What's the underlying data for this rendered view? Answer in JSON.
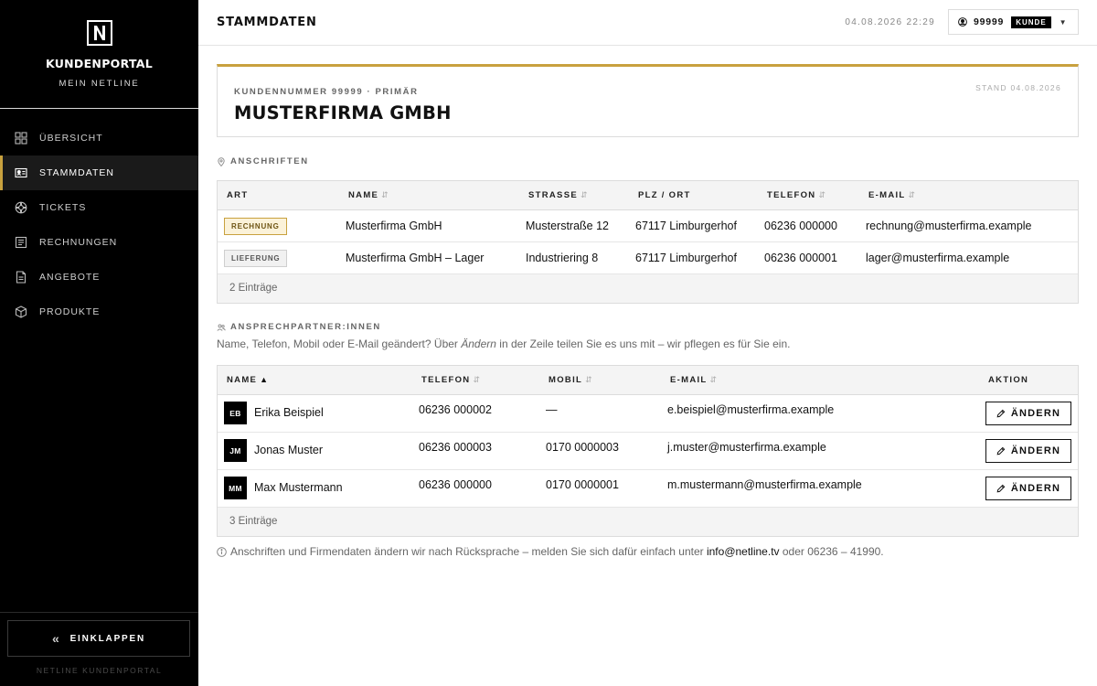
{
  "sidebar": {
    "brand_title": "KUNDENPORTAL",
    "brand_sub": "MEIN NETLINE",
    "items": [
      {
        "label": "ÜBERSICHT",
        "icon": "grid-icon"
      },
      {
        "label": "STAMMDATEN",
        "icon": "id-card-icon",
        "active": true
      },
      {
        "label": "TICKETS",
        "icon": "lifebuoy-icon"
      },
      {
        "label": "RECHNUNGEN",
        "icon": "invoice-icon"
      },
      {
        "label": "ANGEBOTE",
        "icon": "document-icon"
      },
      {
        "label": "PRODUKTE",
        "icon": "box-icon"
      }
    ],
    "collapse_label": "EINKLAPPEN",
    "footer": "NETLINE KUNDENPORTAL"
  },
  "header": {
    "title": "STAMMDATEN",
    "datetime": "04.08.2026 22:29",
    "user_id": "99999",
    "role": "KUNDE"
  },
  "company": {
    "kicker": "KUNDENNUMMER 99999 · PRIMÄR",
    "name": "MUSTERFIRMA GMBH",
    "stand": "STAND 04.08.2026"
  },
  "addresses": {
    "title": "ANSCHRIFTEN",
    "columns": [
      "ART",
      "NAME",
      "STRASSE",
      "PLZ / ORT",
      "TELEFON",
      "E-MAIL"
    ],
    "rows": [
      {
        "type": "RECHNUNG",
        "name": "Musterfirma GmbH",
        "street": "Musterstraße 12",
        "city": "67117 Limburgerhof",
        "phone": "06236 000000",
        "email": "rechnung@musterfirma.example"
      },
      {
        "type": "LIEFERUNG",
        "name": "Musterfirma GmbH – Lager",
        "street": "Industriering 8",
        "city": "67117 Limburgerhof",
        "phone": "06236 000001",
        "email": "lager@musterfirma.example"
      }
    ],
    "count_label": "2 Einträge"
  },
  "contacts": {
    "title": "ANSPRECHPARTNER:INNEN",
    "hint_before": "Name, Telefon, Mobil oder E-Mail geändert? Über ",
    "hint_em": "Ändern",
    "hint_after": " in der Zeile teilen Sie es uns mit – wir pflegen es für Sie ein.",
    "columns": [
      "NAME",
      "TELEFON",
      "MOBIL",
      "E-MAIL",
      "AKTION"
    ],
    "rows": [
      {
        "initials": "EB",
        "name": "Erika Beispiel",
        "phone": "06236 000002",
        "mobile": "—",
        "email": "e.beispiel@musterfirma.example"
      },
      {
        "initials": "JM",
        "name": "Jonas Muster",
        "phone": "06236 000003",
        "mobile": "0170 0000003",
        "email": "j.muster@musterfirma.example"
      },
      {
        "initials": "MM",
        "name": "Max Mustermann",
        "phone": "06236 000000",
        "mobile": "0170 0000001",
        "email": "m.mustermann@musterfirma.example"
      }
    ],
    "edit_label": "ÄNDERN",
    "count_label": "3 Einträge"
  },
  "footnote": {
    "before": "Anschriften und Firmendaten ändern wir nach Rücksprache – melden Sie sich dafür einfach unter ",
    "email": "info@netline.tv",
    "after": " oder 06236 – 41990."
  },
  "colors": {
    "accent": "#c8a13e",
    "sidebar": "#000000"
  }
}
